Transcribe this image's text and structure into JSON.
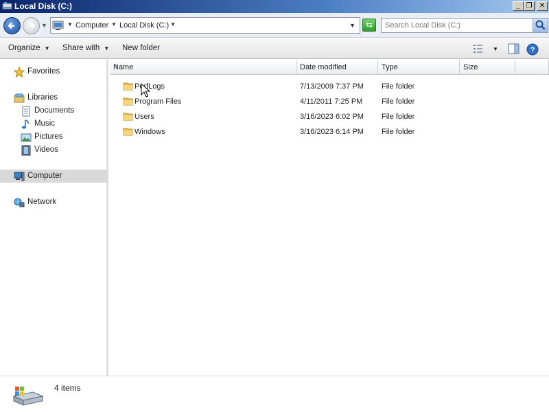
{
  "window": {
    "title": "Local Disk (C:)",
    "controls": {
      "minimize": "_",
      "maximize": "❐",
      "close": "✕"
    }
  },
  "address": {
    "crumbs": [
      "Computer",
      "Local Disk (C:)"
    ],
    "search_placeholder": "Search Local Disk (C:)"
  },
  "toolbar": {
    "organize": "Organize",
    "share_with": "Share with",
    "new_folder": "New folder"
  },
  "nav": {
    "favorites": "Favorites",
    "libraries": "Libraries",
    "documents": "Documents",
    "music": "Music",
    "pictures": "Pictures",
    "videos": "Videos",
    "computer": "Computer",
    "network": "Network"
  },
  "columns": {
    "name": "Name",
    "date_modified": "Date modified",
    "type": "Type",
    "size": "Size"
  },
  "files": [
    {
      "name": "PerfLogs",
      "date": "7/13/2009 7:37 PM",
      "type": "File folder"
    },
    {
      "name": "Program Files",
      "date": "4/11/2011 7:25 PM",
      "type": "File folder"
    },
    {
      "name": "Users",
      "date": "3/16/2023 6:02 PM",
      "type": "File folder"
    },
    {
      "name": "Windows",
      "date": "3/16/2023 6:14 PM",
      "type": "File folder"
    }
  ],
  "status": {
    "item_count": "4 items"
  },
  "colors": {
    "title_bar": "#0a246a",
    "selection": "#d9d9d9",
    "folder": "#e8c15a"
  }
}
